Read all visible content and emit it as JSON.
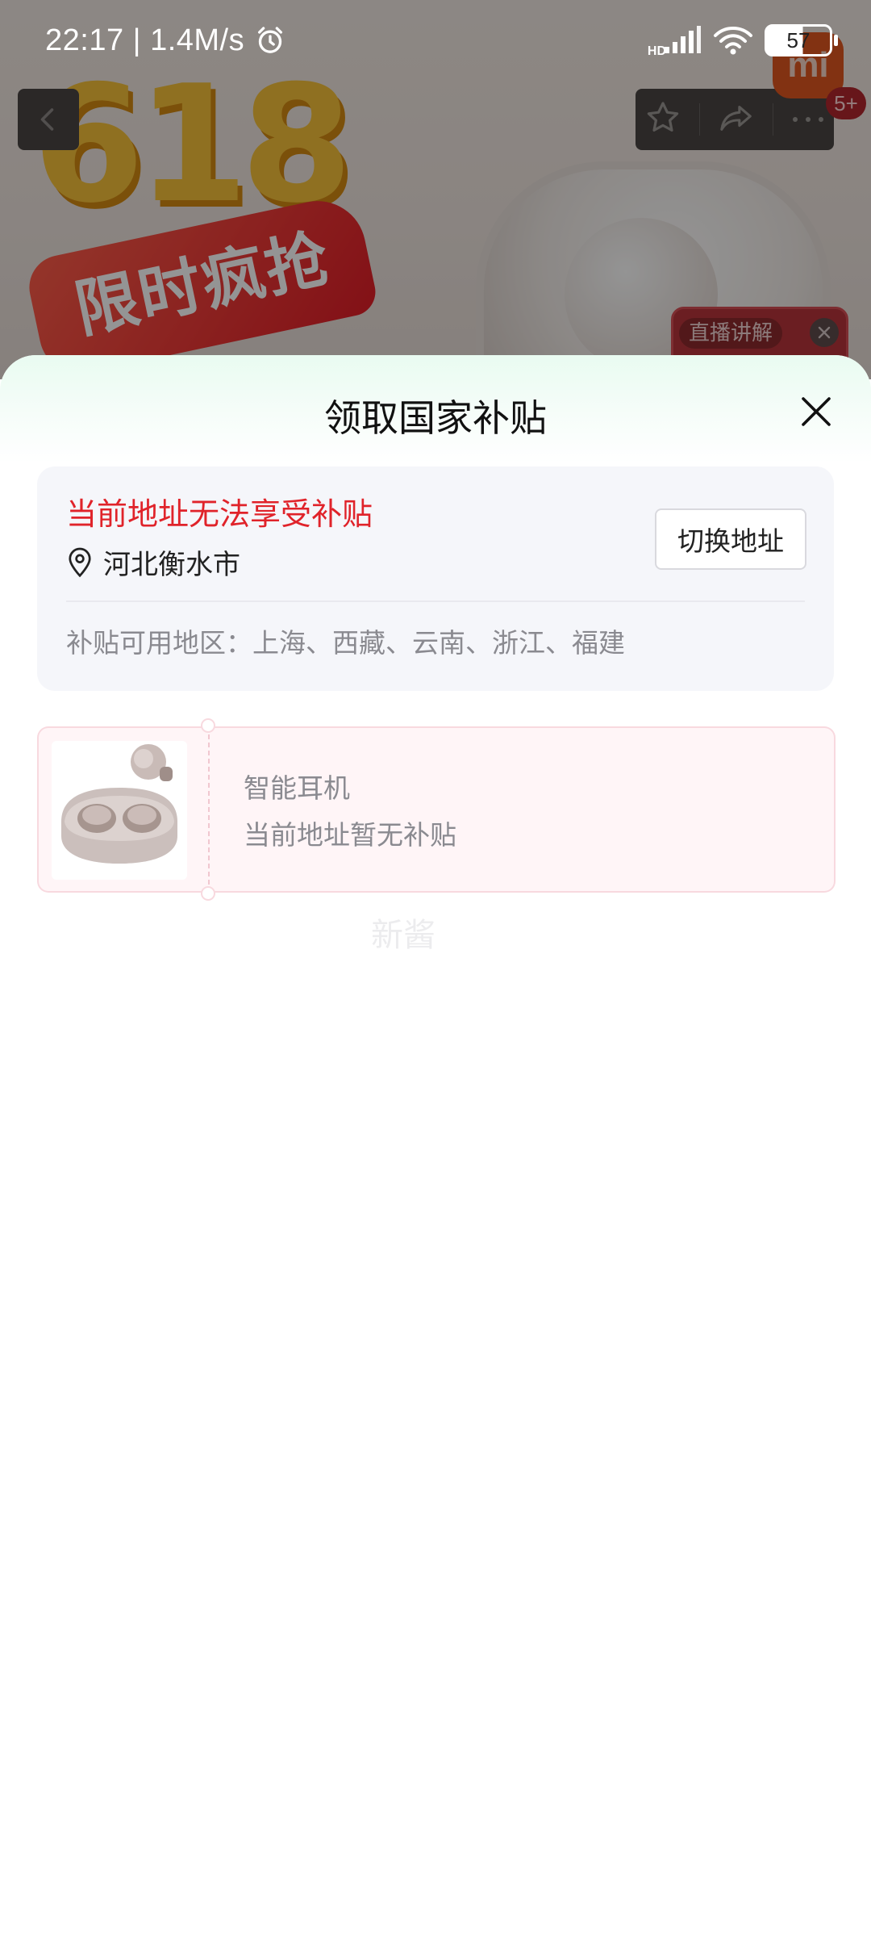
{
  "status_bar": {
    "time": "22:17 | 1.4M/s",
    "network_label": "HD",
    "battery": "57"
  },
  "background_page": {
    "promo_number": "618",
    "promo_text": "限时疯抢",
    "notification_count": "5+",
    "live_label": "直播讲解",
    "brand_logo": "mi"
  },
  "sheet": {
    "title": "领取国家补贴",
    "address_card": {
      "warning": "当前地址无法享受补贴",
      "city": "河北衡水市",
      "switch_button": "切换地址",
      "regions": "补贴可用地区：上海、西藏、云南、浙江、福建"
    },
    "coupon": {
      "product_name": "智能耳机",
      "status": "当前地址暂无补贴"
    },
    "watermark": "新酱"
  },
  "colors": {
    "warning": "#e0232a",
    "sheet_header_tint": "#e9fbf1",
    "coupon_bg": "#fff5f7"
  }
}
